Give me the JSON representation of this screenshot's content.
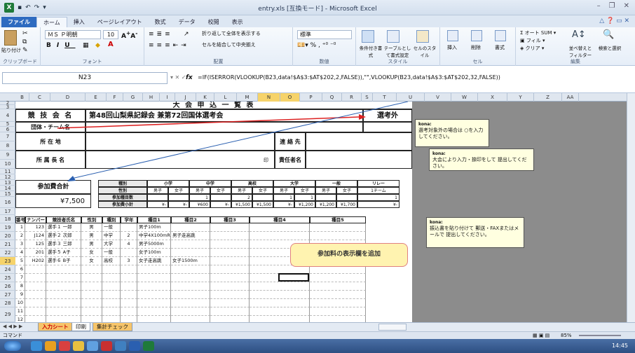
{
  "window": {
    "title": "entry.xls [互換モード] - Microsoft Excel"
  },
  "ribbon_tabs": [
    "ファイル",
    "ホーム",
    "挿入",
    "ページレイアウト",
    "数式",
    "データ",
    "校閲",
    "表示"
  ],
  "ribbon": {
    "paste": "貼り付け",
    "font_name": "ＭＳ Ｐ明朝",
    "font_size": "10",
    "wrap": "折り返して全体を表示する",
    "merge": "セルを結合して中央揃え",
    "number_format": "標準",
    "cond_fmt": "条件付き書式",
    "table_fmt": "テーブルとして書式設定",
    "cell_style": "セルのスタイル",
    "insert": "挿入",
    "delete": "削除",
    "format": "書式",
    "autosum": "オート SUM",
    "fill": "フィル",
    "clear": "クリア",
    "sort": "並べ替えとフィルター",
    "find": "検索と選択",
    "groups": [
      "クリップボード",
      "フォント",
      "配置",
      "数値",
      "スタイル",
      "セル",
      "編集"
    ]
  },
  "formula_bar": {
    "name_box": "N23",
    "formula": "=IF(ISERROR(VLOOKUP(B23,data!$A$3:$AT$202,2,FALSE)),\"\",VLOOKUP(B23,data!$A$3:$AT$202,32,FALSE))"
  },
  "columns": [
    "B",
    "C",
    "D",
    "E",
    "F",
    "G",
    "H",
    "I",
    "J",
    "K",
    "L",
    "M",
    "N",
    "O",
    "P",
    "Q",
    "R",
    "S",
    "T",
    "U",
    "V",
    "W",
    "X",
    "Y",
    "Z",
    "AA"
  ],
  "rows": [
    "2",
    "3",
    "4",
    "5",
    "6",
    "7",
    "8",
    "9",
    "10",
    "11",
    "12",
    "13",
    "14",
    "15",
    "16",
    "17",
    "18",
    "19",
    "20",
    "21",
    "22",
    "23",
    "24",
    "25",
    "26",
    "27",
    "28",
    "29"
  ],
  "sheet": {
    "title": "大 会 申 込 一 覧 表",
    "event_label": "競 技 会 名",
    "event_name": "第48回山梨県記録会 兼第72回国体選考会",
    "exclusion": "選考外",
    "team_label": "団体・チーム名",
    "address_label": "所 在 地",
    "contact_label": "連 絡 先",
    "head_label": "所 属 長 名",
    "seal": "印",
    "resp_label": "責任者名",
    "fee_label": "参加費合計",
    "fee_value": "¥7,500",
    "cat_headers": {
      "type": "種別",
      "sex": "性別",
      "entries": "参加種目数",
      "subtotal": "参加費小計",
      "cats": [
        "小学",
        "中学",
        "高校",
        "大学",
        "一般",
        "リレー"
      ],
      "male": "男子",
      "female": "女子",
      "team": "1チーム"
    },
    "counts": [
      "",
      "",
      "1",
      "",
      "2",
      "",
      "1",
      "1",
      "",
      "",
      "1",
      ""
    ],
    "subtotals": [
      "¥-",
      "¥-",
      "¥600",
      "¥-",
      "¥1,500",
      "¥1,500",
      "¥-",
      "¥1,200",
      "¥1,200",
      "¥1,700",
      "¥-"
    ],
    "table_headers": [
      "番号",
      "ナンバー",
      "競技者氏名",
      "性別",
      "種別",
      "学年",
      "種目1",
      "種目2",
      "種目3",
      "種目4",
      "種目5"
    ],
    "athletes": [
      {
        "no": "1",
        "num": "123",
        "name": "選手１ 一郎",
        "sex": "男",
        "type": "一般",
        "grade": "",
        "e1": "男子100m",
        "e2": ""
      },
      {
        "no": "2",
        "num": "J124",
        "name": "選手２ 次郎",
        "sex": "男",
        "type": "中学",
        "grade": "2",
        "e1": "中学4X100mR",
        "e2": "男子走高跳"
      },
      {
        "no": "3",
        "num": "125",
        "name": "選手３ 三郎",
        "sex": "男",
        "type": "大学",
        "grade": "4",
        "e1": "男子5000m",
        "e2": ""
      },
      {
        "no": "4",
        "num": "201",
        "name": "選手５ A子",
        "sex": "女",
        "type": "一般",
        "grade": "",
        "e1": "女子100m",
        "e2": ""
      },
      {
        "no": "5",
        "num": "H202",
        "name": "選手６ B子",
        "sex": "女",
        "type": "高校",
        "grade": "3",
        "e1": "女子走高跳",
        "e2": "女子1500m"
      },
      {
        "no": "6"
      },
      {
        "no": "7"
      },
      {
        "no": "8"
      },
      {
        "no": "9"
      },
      {
        "no": "10"
      },
      {
        "no": "11"
      },
      {
        "no": "12"
      }
    ]
  },
  "notes": [
    {
      "author": "kona:",
      "text": "選考対象外の場合は ○を入力してください。"
    },
    {
      "author": "kona:",
      "text": "大会により入力・捺印をして 提出してください。"
    },
    {
      "author": "kona:",
      "text": "振込書を貼り付けて 郵送・FAXまたはメールで 提出してください。"
    }
  ],
  "callout": "参加料の表示欄を追加",
  "sheet_tabs": [
    "入力シート",
    "印刷",
    "集計チェック"
  ],
  "status": {
    "mode": "コマンド",
    "zoom": "85%",
    "time": "14:45"
  }
}
